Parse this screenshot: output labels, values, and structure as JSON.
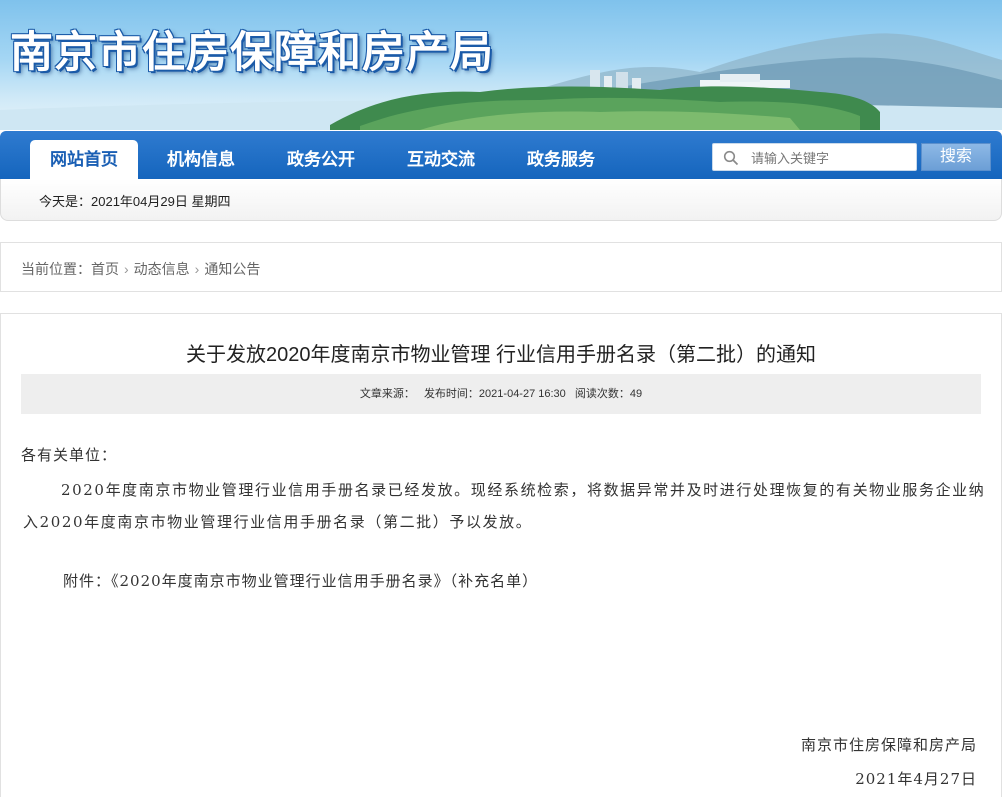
{
  "header": {
    "site_title": "南京市住房保障和房产局"
  },
  "nav": {
    "items": [
      {
        "label": "网站首页",
        "active": true
      },
      {
        "label": "机构信息",
        "active": false
      },
      {
        "label": "政务公开",
        "active": false
      },
      {
        "label": "互动交流",
        "active": false
      },
      {
        "label": "政务服务",
        "active": false
      }
    ],
    "search_placeholder": "请输入关键字",
    "search_button": "搜索"
  },
  "datebar": {
    "today": "今天是：2021年04月29日  星期四"
  },
  "breadcrumb": {
    "prefix": "当前位置：",
    "items": [
      "首页",
      "动态信息",
      "通知公告"
    ],
    "separator": "›"
  },
  "article": {
    "title": "关于发放2020年度南京市物业管理 行业信用手册名录（第二批）的通知",
    "meta": {
      "source": "文章来源：",
      "published": "发布时间：2021-04-27 16:30",
      "reads": "阅读次数：49"
    },
    "greeting": "各有关单位：",
    "paragraph": "2020年度南京市物业管理行业信用手册名录已经发放。现经系统检索，将数据异常并及时进行处理恢复的有关物业服务企业纳入2020年度南京市物业管理行业信用手册名录（第二批）予以发放。",
    "attachment": "附件：《2020年度南京市物业管理行业信用手册名录》（补充名单）",
    "signature_org": "南京市住房保障和房产局",
    "signature_date": "2021年4月27日"
  },
  "colors": {
    "nav_blue": "#1565bd",
    "nav_active_text": "#1a5fb4",
    "title_outline": "#1a5aa8"
  }
}
